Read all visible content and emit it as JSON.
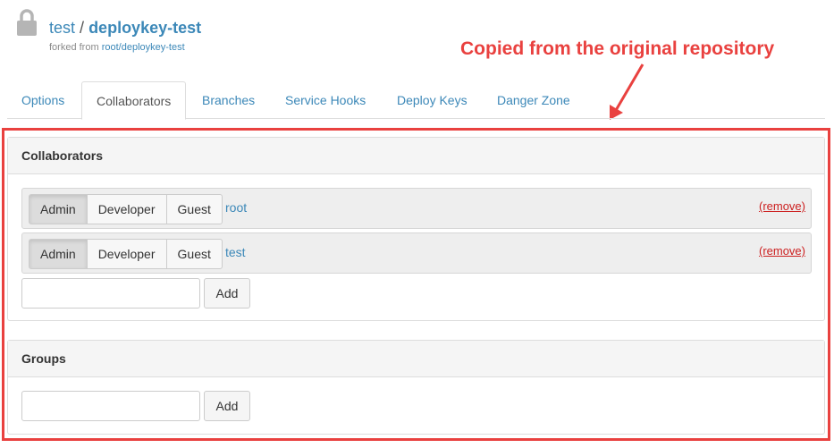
{
  "header": {
    "owner": "test",
    "separator": "/",
    "repo_name": "deploykey-test",
    "forked_prefix": "forked from",
    "forked_source": "root/deploykey-test"
  },
  "annotation": {
    "text": "Copied from the original repository",
    "color": "#e9413f"
  },
  "tabs": [
    {
      "label": "Options",
      "active": false
    },
    {
      "label": "Collaborators",
      "active": true
    },
    {
      "label": "Branches",
      "active": false
    },
    {
      "label": "Service Hooks",
      "active": false
    },
    {
      "label": "Deploy Keys",
      "active": false
    },
    {
      "label": "Danger Zone",
      "active": false
    }
  ],
  "collaborators_panel": {
    "title": "Collaborators",
    "rows": [
      {
        "roles": [
          "Admin",
          "Developer",
          "Guest"
        ],
        "selected_role": "Admin",
        "user": "root",
        "remove_label": "(remove)"
      },
      {
        "roles": [
          "Admin",
          "Developer",
          "Guest"
        ],
        "selected_role": "Admin",
        "user": "test",
        "remove_label": "(remove)"
      }
    ],
    "input_value": "",
    "add_label": "Add"
  },
  "groups_panel": {
    "title": "Groups",
    "input_value": "",
    "add_label": "Add"
  },
  "colors": {
    "link": "#3c88b8",
    "remove": "#cc1f1f",
    "annotation": "#e9413f"
  },
  "icons": {
    "lock": "lock-icon"
  }
}
